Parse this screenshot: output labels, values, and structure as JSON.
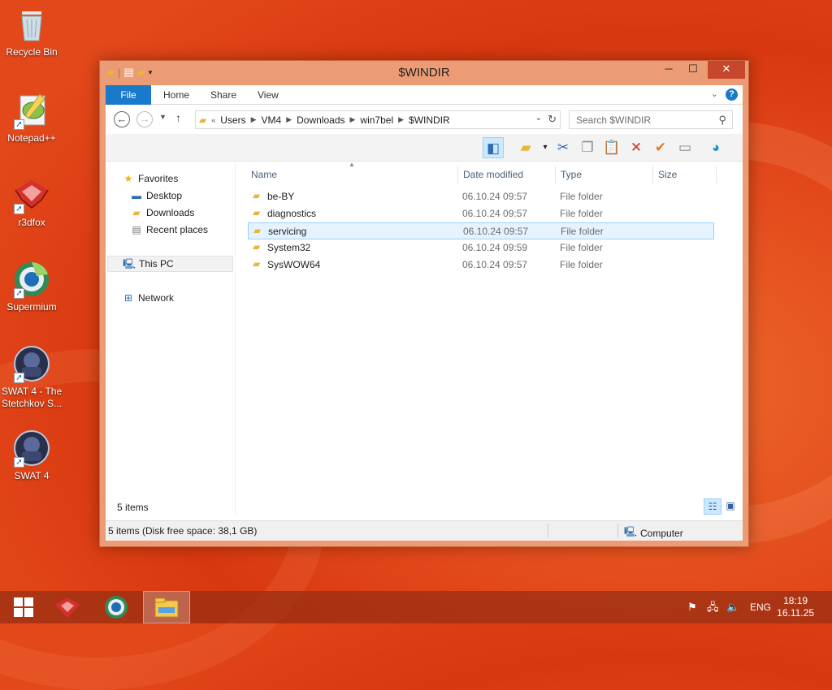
{
  "desktop": {
    "icons": [
      {
        "label": "Recycle Bin"
      },
      {
        "label": "Notepad++"
      },
      {
        "label": "r3dfox"
      },
      {
        "label": "Supermium"
      },
      {
        "label": "SWAT 4 - The Stetchkov S..."
      },
      {
        "label": "SWAT 4"
      }
    ]
  },
  "window": {
    "title": "$WINDIR",
    "ribbon_tabs": [
      "File",
      "Home",
      "Share",
      "View"
    ],
    "breadcrumb": {
      "prefix": "«",
      "items": [
        "Users",
        "VM4",
        "Downloads",
        "win7bel",
        "$WINDIR"
      ]
    },
    "search": {
      "placeholder": "Search $WINDIR"
    },
    "nav_pane": {
      "favorites": "Favorites",
      "favorites_items": [
        "Desktop",
        "Downloads",
        "Recent places"
      ],
      "this_pc": "This PC",
      "network": "Network"
    },
    "columns": [
      "Name",
      "Date modified",
      "Type",
      "Size"
    ],
    "files": [
      {
        "name": "be-BY",
        "date": "06.10.24 09:57",
        "type": "File folder"
      },
      {
        "name": "diagnostics",
        "date": "06.10.24 09:57",
        "type": "File folder"
      },
      {
        "name": "servicing",
        "date": "06.10.24 09:57",
        "type": "File folder",
        "selected": true
      },
      {
        "name": "System32",
        "date": "06.10.24 09:59",
        "type": "File folder"
      },
      {
        "name": "SysWOW64",
        "date": "06.10.24 09:57",
        "type": "File folder"
      }
    ],
    "item_count": "5 items",
    "status_left": "5 items (Disk free space: 38,1 GB)",
    "status_right": "Computer"
  },
  "taskbar": {
    "language": "ENG",
    "time": "18:19",
    "date": "16.11.25"
  },
  "colors": {
    "accent": "#1979ca",
    "selection": "#e5f3ff",
    "desktop": "#e2481b"
  }
}
